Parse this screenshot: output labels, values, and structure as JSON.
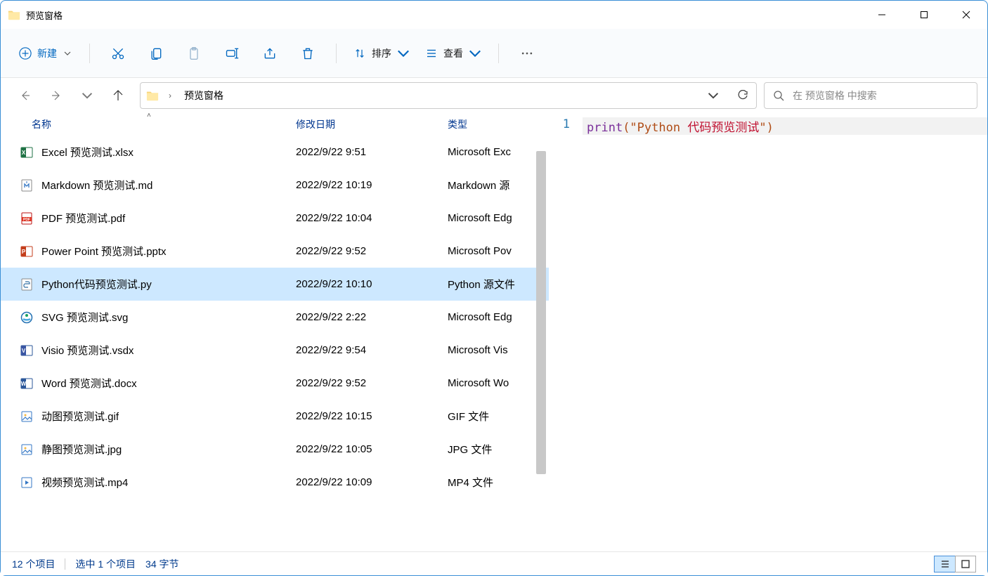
{
  "window": {
    "title": "预览窗格"
  },
  "toolbar": {
    "new_label": "新建",
    "sort_label": "排序",
    "view_label": "查看"
  },
  "breadcrumb": {
    "current": "预览窗格"
  },
  "search": {
    "placeholder": "在 预览窗格 中搜索"
  },
  "columns": {
    "name": "名称",
    "date": "修改日期",
    "type": "类型"
  },
  "files": [
    {
      "icon": "excel",
      "name": "Excel 预览测试.xlsx",
      "date": "2022/9/22 9:51",
      "type": "Microsoft Exc",
      "selected": false
    },
    {
      "icon": "md",
      "name": "Markdown 预览测试.md",
      "date": "2022/9/22 10:19",
      "type": "Markdown 源",
      "selected": false
    },
    {
      "icon": "pdf",
      "name": "PDF 预览测试.pdf",
      "date": "2022/9/22 10:04",
      "type": "Microsoft Edg",
      "selected": false
    },
    {
      "icon": "ppt",
      "name": "Power Point 预览测试.pptx",
      "date": "2022/9/22 9:52",
      "type": "Microsoft Pov",
      "selected": false
    },
    {
      "icon": "py",
      "name": "Python代码预览测试.py",
      "date": "2022/9/22 10:10",
      "type": "Python 源文件",
      "selected": true
    },
    {
      "icon": "svg",
      "name": "SVG 预览测试.svg",
      "date": "2022/9/22 2:22",
      "type": "Microsoft Edg",
      "selected": false
    },
    {
      "icon": "visio",
      "name": "Visio 预览测试.vsdx",
      "date": "2022/9/22 9:54",
      "type": "Microsoft Vis",
      "selected": false
    },
    {
      "icon": "word",
      "name": "Word 预览测试.docx",
      "date": "2022/9/22 9:52",
      "type": "Microsoft Wo",
      "selected": false
    },
    {
      "icon": "gif",
      "name": "动图预览测试.gif",
      "date": "2022/9/22 10:15",
      "type": "GIF 文件",
      "selected": false
    },
    {
      "icon": "jpg",
      "name": "静图预览测试.jpg",
      "date": "2022/9/22 10:05",
      "type": "JPG 文件",
      "selected": false
    },
    {
      "icon": "mp4",
      "name": "视频预览测试.mp4",
      "date": "2022/9/22 10:09",
      "type": "MP4 文件",
      "selected": false
    }
  ],
  "preview": {
    "line_no": "1",
    "code_fn": "print",
    "code_open": "(\"",
    "code_en": "Python ",
    "code_cjk": "代码预览测试",
    "code_close": "\")"
  },
  "status": {
    "count": "12 个项目",
    "selection": "选中 1 个项目",
    "size": "34 字节"
  }
}
